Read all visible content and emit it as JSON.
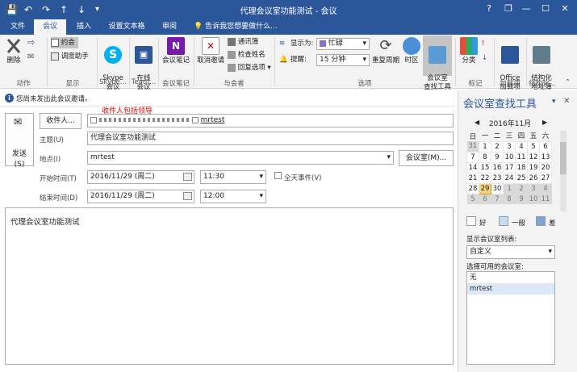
{
  "window": {
    "title": "代理会议室功能测试 - 会议",
    "help_glyph": "?",
    "restore_glyph": "❐",
    "minimize_glyph": "—",
    "maximize_glyph": "☐",
    "close_glyph": "✕"
  },
  "quick_access": {
    "save": "💾",
    "undo": "↶",
    "redo": "↷",
    "up": "↑",
    "down": "↓",
    "more": "▾"
  },
  "tabs": [
    "文件",
    "会议",
    "插入",
    "设置文本格式",
    "审阅"
  ],
  "tell_me": "告诉我您想要做什么...",
  "ribbon": {
    "delete": "删除",
    "forward_glyph": "⇨",
    "junk_glyph": "✉",
    "group_actions": "动作",
    "appointment": "约会",
    "scheduling_assistant": "调度助手",
    "group_show": "显示",
    "skype": "Skype\n会议",
    "group_skype": "Skype...",
    "online_meeting": "在线\n会议",
    "group_teams": "Team...",
    "meeting_notes": "会议笔记",
    "group_meeting_notes": "会议笔记",
    "cancel_invitation": "取消邀请",
    "address_book": "通讯簿",
    "check_names": "检查姓名",
    "response_options": "回复选项",
    "group_attendees": "与会者",
    "show_as_label": "显示为:",
    "show_as_value": "忙碌",
    "reminder_label": "提醒:",
    "reminder_value": "15 分钟",
    "recurrence": "重复周期",
    "time_zones": "时区",
    "room_finder": "会议室\n查找工具",
    "group_options": "选项",
    "categorize": "分类",
    "group_tags": "标记",
    "office_addins": "Office\n加载项",
    "group_addins": "加载项",
    "structured_address": "结构化\n地址簿",
    "group_structured": "结构化..."
  },
  "info": {
    "icon": "i",
    "text": "您尚未发出此会议邀请。"
  },
  "annotation": "收件人包括领导",
  "form": {
    "send": "发送\n(S)",
    "to_button": "收件人...",
    "to_recipient_1": "",
    "to_recipient_2": "mrtest",
    "subject_label": "主题(U)",
    "subject_value": "代理会议室功能测试",
    "location_label": "地点(I)",
    "location_value": "mrtest",
    "rooms_button": "会议室(M)...",
    "start_label": "开始时间(T)",
    "start_date": "2016/11/29 (周二)",
    "start_time": "11:30",
    "all_day_label": "全天事件(V)",
    "end_label": "结束时间(D)",
    "end_date": "2016/11/29 (周二)",
    "end_time": "12:00",
    "body_text": "代理会议室功能测试"
  },
  "room_finder": {
    "title": "会议室查找工具",
    "month": "2016年11月",
    "weekdays": [
      "日",
      "一",
      "二",
      "三",
      "四",
      "五",
      "六"
    ],
    "weeks": [
      [
        "31",
        "1",
        "2",
        "3",
        "4",
        "5",
        "6"
      ],
      [
        "7",
        "8",
        "9",
        "10",
        "11",
        "12",
        "13"
      ],
      [
        "14",
        "15",
        "16",
        "17",
        "18",
        "19",
        "20"
      ],
      [
        "21",
        "22",
        "23",
        "24",
        "25",
        "26",
        "27"
      ],
      [
        "28",
        "29",
        "30",
        "1",
        "2",
        "3",
        "4"
      ],
      [
        "5",
        "6",
        "7",
        "8",
        "9",
        "10",
        "11"
      ]
    ],
    "selected_day": "29",
    "legend_good": "好",
    "legend_fair": "一般",
    "legend_poor": "差",
    "room_list_label": "显示会议室列表:",
    "room_list_value": "自定义",
    "available_label": "选择可用的会议室:",
    "rooms": [
      "无",
      "mrtest"
    ]
  },
  "colors": {
    "brand": "#2b579a",
    "annotation_red": "#e00000",
    "today": "#f7d37e"
  }
}
